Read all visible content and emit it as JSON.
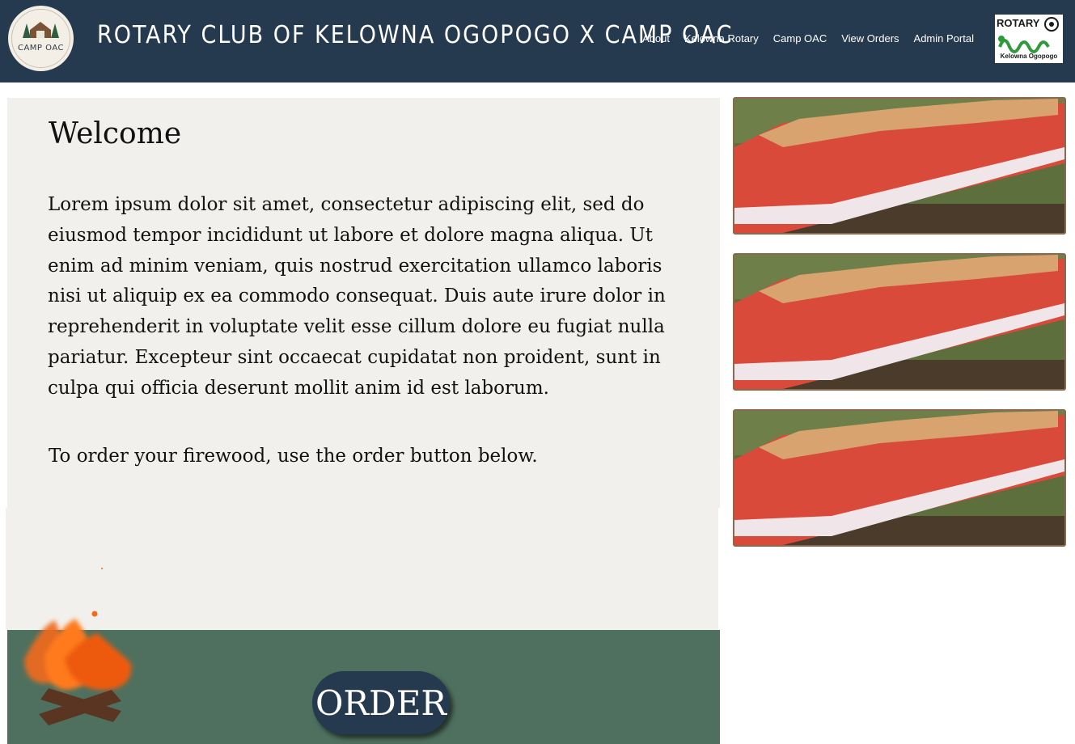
{
  "header": {
    "logo_text": "CAMP OAC",
    "site_title": "Rotary Club of Kelowna Ogopogo x Camp OAC",
    "nav": [
      {
        "label": "About"
      },
      {
        "label": "Kelowna Rotary"
      },
      {
        "label": "Camp OAC"
      },
      {
        "label": "View Orders"
      },
      {
        "label": "Admin Portal"
      }
    ],
    "rotary_logo": {
      "word": "ROTARY",
      "sub": "Kelowna Ogopogo"
    }
  },
  "welcome": {
    "title": "Welcome",
    "body": "Lorem ipsum dolor sit amet, consectetur adipiscing elit, sed do eiusmod tempor incididunt ut labore et dolore magna aliqua. Ut enim ad minim veniam, quis nostrud exercitation ullamco laboris nisi ut aliquip ex ea commodo consequat. Duis aute irure dolor in reprehenderit in voluptate velit esse cillum dolore eu fugiat nulla pariatur. Excepteur sint occaecat cupidatat non proident, sunt in culpa qui officia deserunt mollit anim id est laborum.",
    "order_instruction": "To order your firewood, use the order button below."
  },
  "order": {
    "button_label": "ORDER"
  },
  "colors": {
    "header_bg": "#263a4f",
    "panel_bg": "#f2f0ec",
    "order_strip_bg": "#4f705f",
    "button_bg": "#263a4f",
    "flame": "#f26a1b",
    "photo_border": "#8a6a4f"
  },
  "gallery": [
    {
      "icon": "firewood-bags-photo"
    },
    {
      "icon": "firewood-bags-photo"
    },
    {
      "icon": "firewood-bags-photo"
    }
  ]
}
